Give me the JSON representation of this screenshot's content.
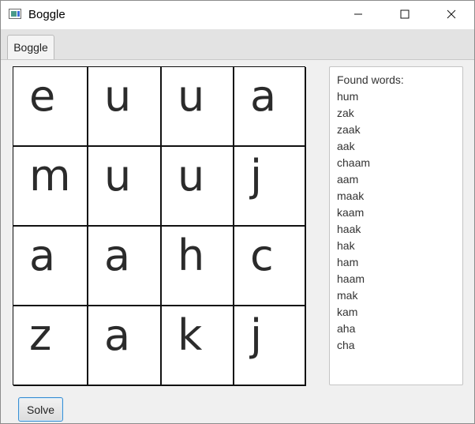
{
  "window": {
    "title": "Boggle"
  },
  "tabs": [
    {
      "label": "Boggle"
    }
  ],
  "board": {
    "rows": [
      [
        "e",
        "u",
        "u",
        "a"
      ],
      [
        "m",
        "u",
        "u",
        "j"
      ],
      [
        "a",
        "a",
        "h",
        "c"
      ],
      [
        "z",
        "a",
        "k",
        "j"
      ]
    ]
  },
  "found": {
    "header": "Found words:",
    "words": [
      "hum",
      "zak",
      "zaak",
      "aak",
      "chaam",
      "aam",
      "maak",
      "kaam",
      "haak",
      "hak",
      "ham",
      "haam",
      "mak",
      "kam",
      "aha",
      "cha"
    ]
  },
  "solve_label": "Solve",
  "icons": {
    "app": "app-window-icon",
    "minimize": "minimize-icon",
    "maximize": "maximize-icon",
    "close": "close-icon"
  }
}
